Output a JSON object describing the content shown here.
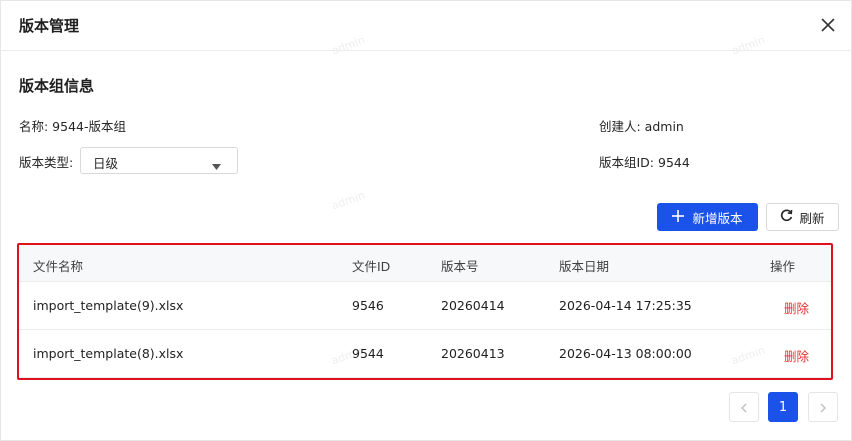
{
  "dialog": {
    "title": "版本管理",
    "close_icon": "close-icon"
  },
  "section": {
    "title": "版本组信息"
  },
  "info": {
    "name": "名称: 9544-版本组",
    "creator": "创建人: admin",
    "type_label": "版本类型:",
    "type_value": "日级",
    "group_id": "版本组ID: 9544"
  },
  "toolbar": {
    "add_label": "新增版本",
    "add_icon": "plus-icon",
    "refresh_label": "刷新",
    "refresh_icon": "refresh-icon"
  },
  "table": {
    "headers": [
      "文件名称",
      "文件ID",
      "版本号",
      "版本日期",
      "操作"
    ],
    "rows": [
      {
        "file_name": "import_template(9).xlsx",
        "file_id": "9546",
        "version": "20260414",
        "date": "2026-04-14 17:25:35",
        "action": "删除"
      },
      {
        "file_name": "import_template(8).xlsx",
        "file_id": "9544",
        "version": "20260413",
        "date": "2026-04-13 08:00:00",
        "action": "删除"
      }
    ]
  },
  "pagination": {
    "current_page": "1"
  },
  "watermark": "admin",
  "colors": {
    "primary": "#1b53ea",
    "danger": "#e5322d",
    "highlight_border": "#e0101f"
  }
}
